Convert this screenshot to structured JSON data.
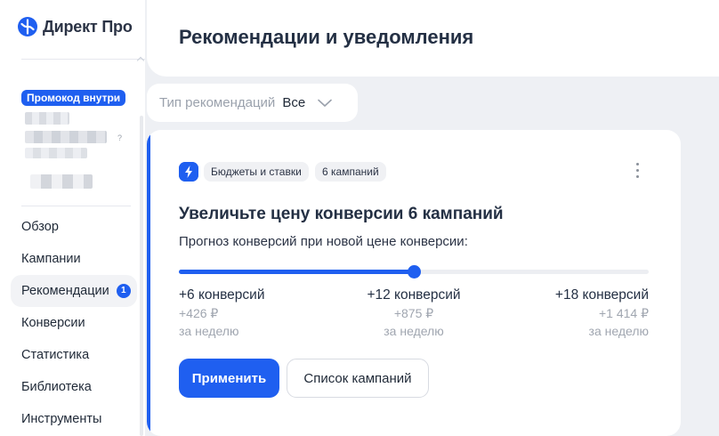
{
  "app": {
    "logo_text": "Директ Про",
    "colors": {
      "accent": "#1f5ff0",
      "background": "#eef0f4"
    }
  },
  "sidebar": {
    "promo_label": "Промокод внутри",
    "items": [
      {
        "label": "Обзор",
        "active": false
      },
      {
        "label": "Кампании",
        "active": false
      },
      {
        "label": "Рекомендации",
        "active": true,
        "badge": "1"
      },
      {
        "label": "Конверсии",
        "active": false
      },
      {
        "label": "Статистика",
        "active": false
      },
      {
        "label": "Библиотека",
        "active": false
      },
      {
        "label": "Инструменты",
        "active": false
      }
    ]
  },
  "header": {
    "title": "Рекомендации и уведомления"
  },
  "filter": {
    "label": "Тип рекомендаций",
    "value": "Все",
    "icon": "chevron-down-icon"
  },
  "card": {
    "icon": "lightning-icon",
    "tags": [
      "Бюджеты и ставки",
      "6 кампаний"
    ],
    "title": "Увеличьте цену конверсии 6 кампаний",
    "subtitle": "Прогноз конверсий при новой цене конверсии:",
    "slider_fraction": 0.5,
    "options": [
      {
        "conversions": "+6 конверсий",
        "money": "+426 ₽",
        "period": "за неделю"
      },
      {
        "conversions": "+12 конверсий",
        "money": "+875 ₽",
        "period": "за неделю"
      },
      {
        "conversions": "+18 конверсий",
        "money": "+1 414 ₽",
        "period": "за неделю"
      }
    ],
    "apply_label": "Применить",
    "campaigns_label": "Список кампаний"
  }
}
